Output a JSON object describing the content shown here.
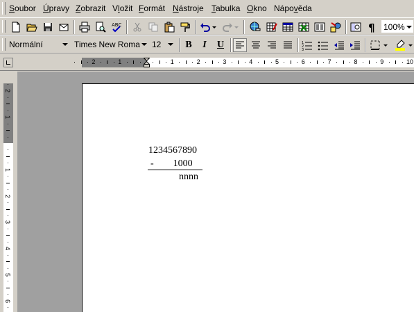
{
  "menubar": {
    "items": [
      {
        "pre": "",
        "key": "S",
        "post": "oubor"
      },
      {
        "pre": "",
        "key": "Ú",
        "post": "pravy"
      },
      {
        "pre": "",
        "key": "Z",
        "post": "obrazit"
      },
      {
        "pre": "V",
        "key": "l",
        "post": "ožit"
      },
      {
        "pre": "",
        "key": "F",
        "post": "ormát"
      },
      {
        "pre": "",
        "key": "N",
        "post": "ástroje"
      },
      {
        "pre": "",
        "key": "T",
        "post": "abulka"
      },
      {
        "pre": "",
        "key": "O",
        "post": "kno"
      },
      {
        "pre": "Nápo",
        "key": "v",
        "post": "ěda"
      }
    ]
  },
  "standard_toolbar": {
    "zoom": "100%"
  },
  "formatting_toolbar": {
    "style": "Normální",
    "font": "Times New Roma",
    "size": "12",
    "bold": "B",
    "italic": "I",
    "underline": "U"
  },
  "hruler": {
    "labels": [
      "2",
      "1",
      "1",
      "2",
      "3",
      "4",
      "5",
      "6",
      "7",
      "8",
      "9",
      "10"
    ]
  },
  "vruler": {
    "labels": [
      "2",
      "1",
      "1",
      "2",
      "3",
      "4",
      "5",
      "6"
    ]
  },
  "document": {
    "lines": [
      "1234567890",
      "-        1000",
      "nnnn"
    ]
  },
  "colors": {
    "highlight": "#ffff00",
    "workspace": "#a0a0a0",
    "chrome": "#d4d0c8"
  }
}
